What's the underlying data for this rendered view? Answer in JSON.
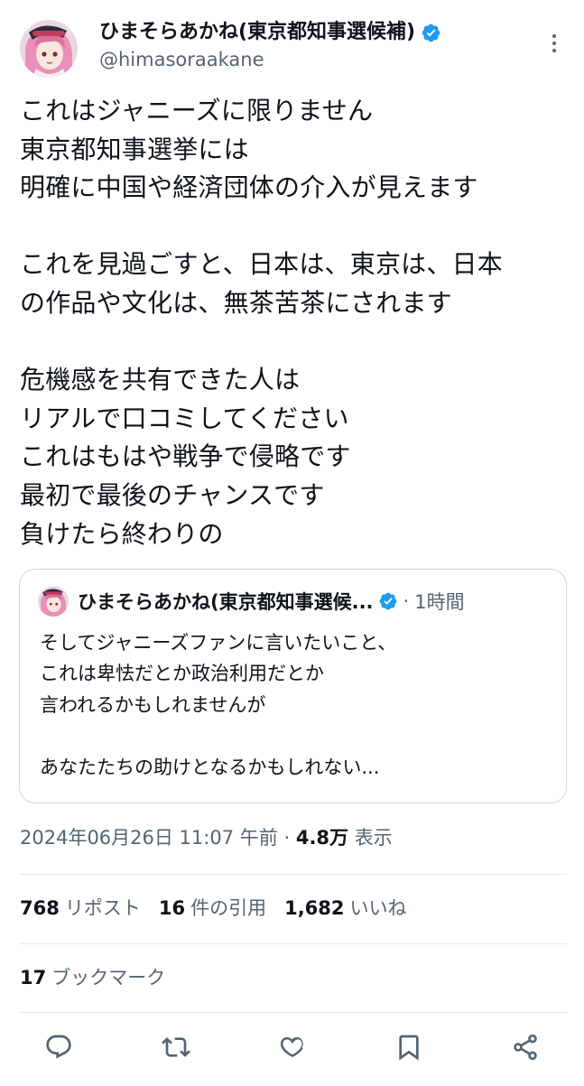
{
  "author": {
    "display_name": "ひまそらあかね(東京都知事選候補)",
    "handle": "@himasoraakane",
    "verified": true,
    "avatar_icon": "anime-avatar-icon"
  },
  "tweet": {
    "lines": [
      "これはジャニーズに限りません",
      "東京都知事選挙には",
      "明確に中国や経済団体の介入が見えます",
      "",
      "これを見過ごすと、日本は、東京は、日本",
      "の作品や文化は、無茶苦茶にされます",
      "",
      "危機感を共有できた人は",
      "リアルで口コミしてください",
      "これはもはや戦争で侵略です",
      "最初で最後のチャンスです",
      "負けたら終わりの"
    ]
  },
  "quote": {
    "display_name": "ひまそらあかね(東京都知事選候...",
    "separator": "·",
    "time": "1時間",
    "lines": [
      "そしてジャニーズファンに言いたいこと、",
      "これは卑怯だとか政治利用だとか",
      "言われるかもしれませんが",
      "",
      "あなたたちの助けとなるかもしれない..."
    ]
  },
  "meta": {
    "timestamp": "2024年06月26日 11:07 午前",
    "separator": "·",
    "views_count": "4.8万",
    "views_label": "表示"
  },
  "stats": {
    "reposts_count": "768",
    "reposts_label": "リポスト",
    "quotes_count": "16",
    "quotes_label": "件の引用",
    "likes_count": "1,682",
    "likes_label": "いいね",
    "bookmarks_count": "17",
    "bookmarks_label": "ブックマーク"
  },
  "actions": [
    "reply-icon",
    "repost-icon",
    "like-icon",
    "bookmark-icon",
    "share-icon"
  ],
  "colors": {
    "verified_blue": "#1d9bf0",
    "secondary_text": "#536471",
    "primary_text": "#0f1419",
    "border": "#cfd9de"
  }
}
